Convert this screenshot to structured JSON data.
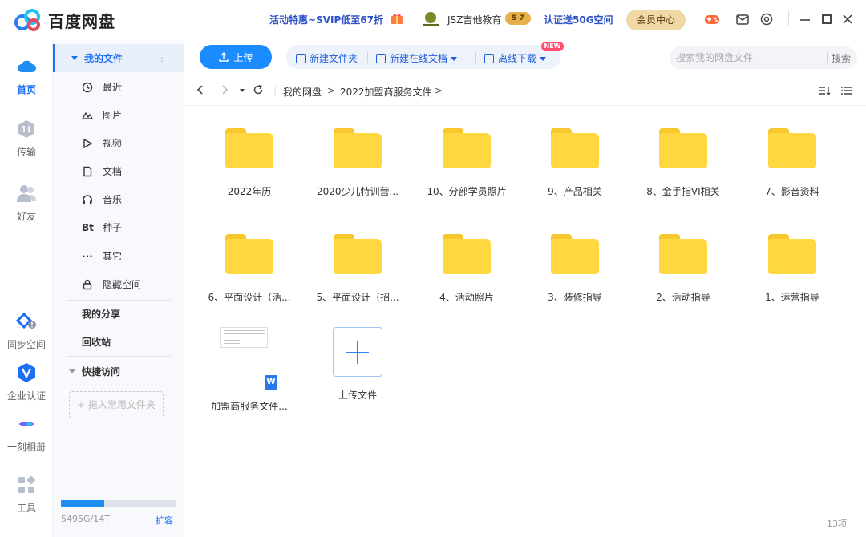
{
  "app": {
    "name": "百度网盘",
    "promo": "活动特惠~SVIP低至67折",
    "edu_name": "JSZ吉他教育",
    "edu_badge": "5 7",
    "auth_promo": "认证送50G空间",
    "vip_center": "会员中心",
    "brand_color": "#1e6ef4"
  },
  "rail": [
    {
      "label": "首页",
      "icon": "cloud-icon",
      "active": true
    },
    {
      "label": "传输",
      "icon": "transfer-icon"
    },
    {
      "label": "好友",
      "icon": "friends-icon"
    },
    {
      "label": "同步空间",
      "icon": "sync-space-icon"
    },
    {
      "label": "企业认证",
      "icon": "enterprise-icon"
    },
    {
      "label": "一刻相册",
      "icon": "album-icon"
    },
    {
      "label": "工具",
      "icon": "tools-icon"
    }
  ],
  "sidebar": {
    "my_files": "我的文件",
    "more": "⋮",
    "items": [
      {
        "label": "最近",
        "icon": "clock-icon"
      },
      {
        "label": "图片",
        "icon": "picture-icon"
      },
      {
        "label": "视频",
        "icon": "video-icon"
      },
      {
        "label": "文档",
        "icon": "document-icon"
      },
      {
        "label": "音乐",
        "icon": "music-icon"
      },
      {
        "label": "种子",
        "icon": "bt-icon"
      },
      {
        "label": "其它",
        "icon": "more-icon"
      },
      {
        "label": "隐藏空间",
        "icon": "lock-icon"
      }
    ],
    "my_share": "我的分享",
    "recycle": "回收站",
    "quick_access": "快捷访问",
    "drop_hint": "+ 拖入常用文件夹",
    "quota_text": "5495G/14T",
    "quota_fraction": 0.38,
    "expand": "扩容"
  },
  "toolbar": {
    "upload": "上传",
    "new_folder": "新建文件夹",
    "new_doc": "新建在线文档",
    "new_badge": "NEW",
    "offline": "离线下载",
    "search_placeholder": "搜索我的网盘文件",
    "search_button": "搜索"
  },
  "nav": {
    "crumbs": [
      "我的网盘",
      "2022加盟商服务文件"
    ],
    "sep": ">"
  },
  "files": [
    {
      "name": "2022年历",
      "type": "folder"
    },
    {
      "name": "2020少儿特训营...",
      "type": "folder"
    },
    {
      "name": "10、分部学员照片",
      "type": "folder"
    },
    {
      "name": "9、产品相关",
      "type": "folder"
    },
    {
      "name": "8、金手指VI相关",
      "type": "folder"
    },
    {
      "name": "7、影音资料",
      "type": "folder"
    },
    {
      "name": "6、平面设计（活...",
      "type": "folder"
    },
    {
      "name": "5、平面设计（招...",
      "type": "folder"
    },
    {
      "name": "4、活动照片",
      "type": "folder"
    },
    {
      "name": "3、装修指导",
      "type": "folder"
    },
    {
      "name": "2、活动指导",
      "type": "folder"
    },
    {
      "name": "1、运营指导",
      "type": "folder"
    },
    {
      "name": "加盟商服务文件...",
      "type": "word"
    },
    {
      "name": "上传文件",
      "type": "upload"
    }
  ],
  "status": {
    "count": "13项"
  }
}
